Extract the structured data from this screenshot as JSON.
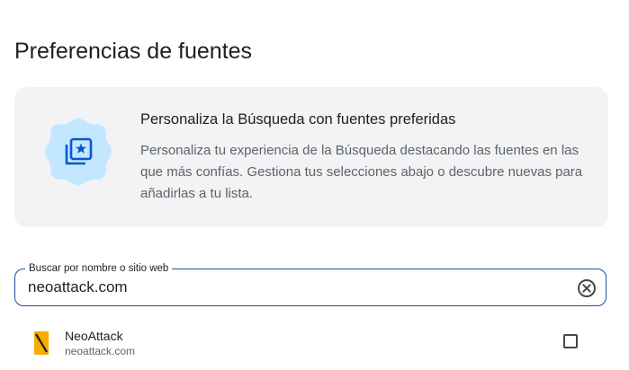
{
  "page": {
    "title": "Preferencias de fuentes"
  },
  "info_card": {
    "icon": "star-photo-badge-icon",
    "title": "Personaliza la Búsqueda con fuentes preferidas",
    "description": "Personaliza tu experiencia de la Búsqueda destacando las fuentes en las que más confías. Gestiona tus selecciones abajo o descubre nuevas para añadirlas a tu lista."
  },
  "search": {
    "label": "Buscar por nombre o sitio web",
    "value": "neoattack.com",
    "clear_icon": "clear-circle-icon"
  },
  "results": [
    {
      "name": "NeoAttack",
      "url": "neoattack.com",
      "logo_icon": "neoattack-logo-icon",
      "checked": false
    }
  ],
  "colors": {
    "accent": "#1a4fa3",
    "card_background": "#f1f3f4",
    "badge_background": "#c2e7ff",
    "badge_icon": "#0b57d0",
    "logo_orange": "#f9ab00"
  }
}
